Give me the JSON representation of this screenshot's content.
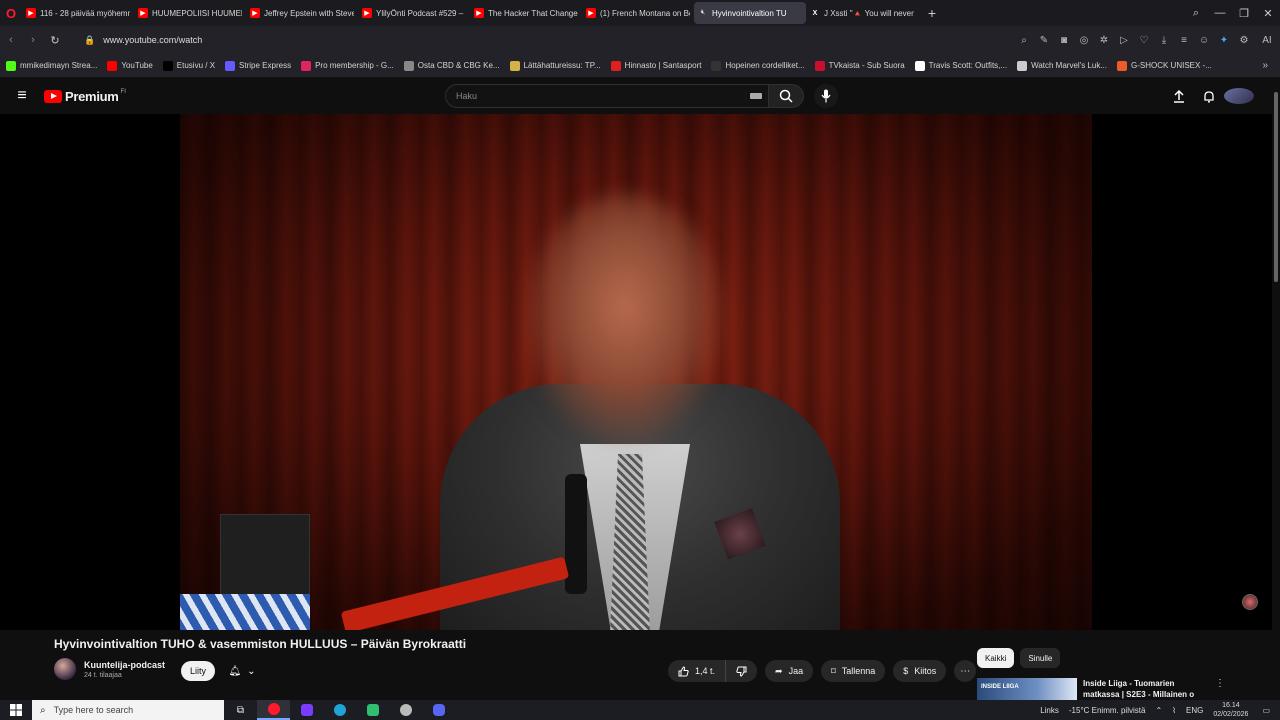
{
  "browser": {
    "tabs": [
      {
        "label": "116 - 28 päivää myöhemm",
        "icon": "youtube-icon",
        "active": false
      },
      {
        "label": "HUUMEPOLIISI HUUMEK",
        "icon": "youtube-icon",
        "active": false
      },
      {
        "label": "Jeffrey Epstein with Steve",
        "icon": "youtube-icon",
        "active": false
      },
      {
        "label": "YlilyÖnti Podcast #529 – L",
        "icon": "youtube-icon",
        "active": false
      },
      {
        "label": "The Hacker That Changed",
        "icon": "youtube-icon",
        "active": false
      },
      {
        "label": "(1) French Montana on Be",
        "icon": "youtube-icon",
        "active": false
      },
      {
        "label": "Hyvinvointivaltion TU",
        "icon": "speaker-muted-icon",
        "active": true
      },
      {
        "label": "J Xssti \"🔺 You will never",
        "icon": "x-logo-icon",
        "active": false
      }
    ],
    "url": "www.youtube.com/watch",
    "bookmarks": [
      {
        "label": "mmikedimayn Strea...",
        "color": "#53fc18"
      },
      {
        "label": "YouTube",
        "color": "#ff0000"
      },
      {
        "label": "Etusivu / X",
        "color": "#000000"
      },
      {
        "label": "Stripe Express",
        "color": "#635bff"
      },
      {
        "label": "Pro membership - G...",
        "color": "#e0245e"
      },
      {
        "label": "Osta CBD & CBG Ke...",
        "color": "#888888"
      },
      {
        "label": "Lättähattureissu: TP...",
        "color": "#d4b24a"
      },
      {
        "label": "Hinnasto | Santasport",
        "color": "#e02020"
      },
      {
        "label": "Hopeinen cordelliket...",
        "color": "#333333"
      },
      {
        "label": "TVkaista - Sub Suora",
        "color": "#c8102e"
      },
      {
        "label": "Travis Scott: Outfits,...",
        "color": "#ffffff"
      },
      {
        "label": "Watch Marvel's Luk...",
        "color": "#cccccc"
      },
      {
        "label": "G-SHOCK UNISEX -...",
        "color": "#f05a28"
      }
    ]
  },
  "youtube": {
    "brand": "Premium",
    "region": "FI",
    "search_placeholder": "Haku"
  },
  "video": {
    "title": "Hyvinvointivaltion TUHO & vasemmiston HULLUUS – Päivän Byrokraatti",
    "channel_name": "Kuuntelija-podcast",
    "subscribers": "24 t. tilaajaa",
    "join_label": "Liity",
    "likes": "1,4 t.",
    "share_label": "Jaa",
    "save_label": "Tallenna",
    "thanks_label": "Kiitos"
  },
  "sidebar": {
    "chips": [
      "Kaikki",
      "Sinulle"
    ],
    "recommendation": {
      "thumb_text": "INSIDE LIIGA",
      "title": "Inside Liiga - Tuomarien matkassa | S2E3 - Millainen o"
    }
  },
  "taskbar": {
    "search_placeholder": "Type here to search",
    "links_label": "Links",
    "weather": "-15°C  Enimm. pilvistä",
    "language": "ENG",
    "time": "16.14",
    "date": "02/02/2026"
  }
}
